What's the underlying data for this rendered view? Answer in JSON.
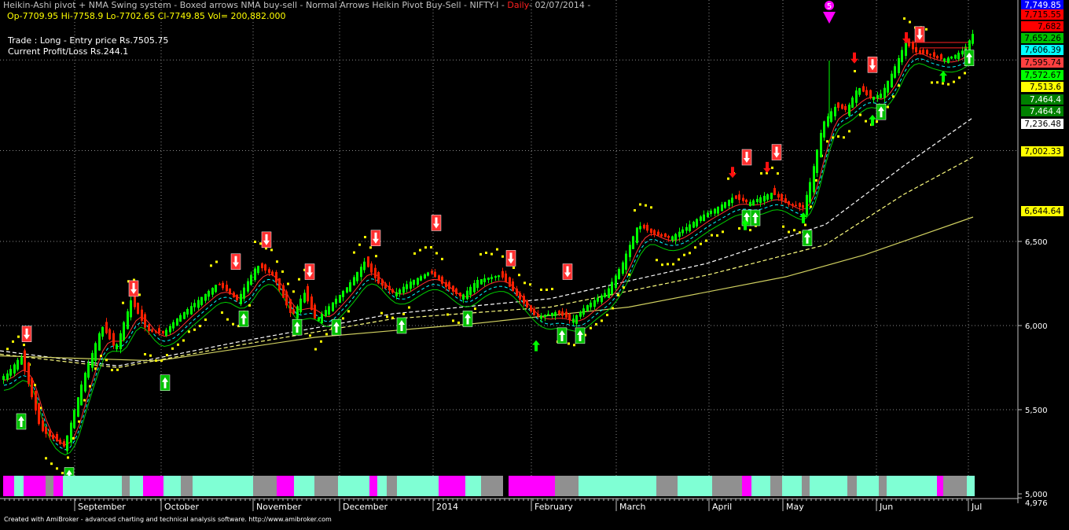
{
  "header": {
    "title": "Heikin-Ashi pivot + NMA Swing system - Boxed arrows NMA buy-sell - Normal Arrows Heikin Pivot Buy-Sell - NIFTY-I -",
    "period": "Daily",
    "date": "- 02/07/2014 -",
    "ohlc": "Op-7709.95  Hi-7758.9  Lo-7702.65  Cl-7749.85  Vol= 200,882.000"
  },
  "trade_info": {
    "line1": "Trade : Long - Entry price Rs.7505.75",
    "line2": "Current Profit/Loss Rs.244.1"
  },
  "footer": {
    "credit": "Created with AmiBroker - advanced charting and technical analysis software. http://www.amibroker.com"
  },
  "colors": {
    "background": "#000000",
    "bull_candle": "#00ff00",
    "bear_candle": "#ff2000",
    "buy_box": "#00c000",
    "sell_box": "#ff3030",
    "wave_marker": "#ff00ff",
    "grid": "#808080"
  },
  "chart_data": {
    "type": "candlestick",
    "symbol": "NIFTY-I",
    "period": "Daily",
    "ylim": [
      4970,
      7800
    ],
    "yticks": [
      {
        "label": "6,500",
        "value": 6500
      },
      {
        "label": "6,000",
        "value": 6000
      },
      {
        "label": "5,500",
        "value": 5500
      },
      {
        "label": "5,000",
        "value": 5000
      },
      {
        "label": "4,976",
        "value": 4976
      }
    ],
    "x_labels": [
      "September",
      "October",
      "November",
      "December",
      "2014",
      "February",
      "March",
      "April",
      "May",
      "Jun",
      "Jul"
    ],
    "price_keypoints": [
      {
        "x": 5,
        "y": 5700
      },
      {
        "x": 25,
        "y": 5820
      },
      {
        "x": 50,
        "y": 5380
      },
      {
        "x": 80,
        "y": 5280
      },
      {
        "x": 105,
        "y": 5700
      },
      {
        "x": 128,
        "y": 6000
      },
      {
        "x": 145,
        "y": 5860
      },
      {
        "x": 165,
        "y": 6150
      },
      {
        "x": 185,
        "y": 5970
      },
      {
        "x": 205,
        "y": 5950
      },
      {
        "x": 225,
        "y": 6050
      },
      {
        "x": 250,
        "y": 6150
      },
      {
        "x": 275,
        "y": 6250
      },
      {
        "x": 300,
        "y": 6150
      },
      {
        "x": 325,
        "y": 6360
      },
      {
        "x": 345,
        "y": 6300
      },
      {
        "x": 370,
        "y": 6050
      },
      {
        "x": 385,
        "y": 6200
      },
      {
        "x": 400,
        "y": 6030
      },
      {
        "x": 420,
        "y": 6130
      },
      {
        "x": 440,
        "y": 6230
      },
      {
        "x": 462,
        "y": 6380
      },
      {
        "x": 480,
        "y": 6250
      },
      {
        "x": 500,
        "y": 6190
      },
      {
        "x": 520,
        "y": 6260
      },
      {
        "x": 545,
        "y": 6320
      },
      {
        "x": 565,
        "y": 6230
      },
      {
        "x": 585,
        "y": 6170
      },
      {
        "x": 605,
        "y": 6270
      },
      {
        "x": 635,
        "y": 6300
      },
      {
        "x": 655,
        "y": 6180
      },
      {
        "x": 680,
        "y": 6050
      },
      {
        "x": 705,
        "y": 6080
      },
      {
        "x": 725,
        "y": 6030
      },
      {
        "x": 745,
        "y": 6120
      },
      {
        "x": 770,
        "y": 6200
      },
      {
        "x": 790,
        "y": 6370
      },
      {
        "x": 810,
        "y": 6600
      },
      {
        "x": 830,
        "y": 6540
      },
      {
        "x": 850,
        "y": 6520
      },
      {
        "x": 870,
        "y": 6580
      },
      {
        "x": 890,
        "y": 6650
      },
      {
        "x": 910,
        "y": 6700
      },
      {
        "x": 930,
        "y": 6760
      },
      {
        "x": 950,
        "y": 6730
      },
      {
        "x": 965,
        "y": 6760
      },
      {
        "x": 980,
        "y": 6790
      },
      {
        "x": 1000,
        "y": 6720
      },
      {
        "x": 1020,
        "y": 6700
      },
      {
        "x": 1030,
        "y": 6870
      },
      {
        "x": 1045,
        "y": 7200
      },
      {
        "x": 1060,
        "y": 7300
      },
      {
        "x": 1075,
        "y": 7280
      },
      {
        "x": 1090,
        "y": 7420
      },
      {
        "x": 1105,
        "y": 7350
      },
      {
        "x": 1120,
        "y": 7380
      },
      {
        "x": 1135,
        "y": 7520
      },
      {
        "x": 1150,
        "y": 7680
      },
      {
        "x": 1165,
        "y": 7620
      },
      {
        "x": 1180,
        "y": 7610
      },
      {
        "x": 1195,
        "y": 7580
      },
      {
        "x": 1210,
        "y": 7600
      },
      {
        "x": 1225,
        "y": 7640
      },
      {
        "x": 1238,
        "y": 7749.85
      }
    ],
    "last_bar": {
      "open": 7709.95,
      "high": 7758.9,
      "low": 7702.65,
      "close": 7749.85,
      "volume": 200882
    },
    "price_labels": [
      {
        "text": "7,749.85",
        "value": 7749.85,
        "bg": "#0000ff",
        "fg": "#ffffff"
      },
      {
        "text": "7,715.55",
        "value": 7715.55,
        "bg": "#ff0000",
        "fg": "#000000"
      },
      {
        "text": "7,682",
        "value": 7682,
        "bg": "#ff0000",
        "fg": "#000000"
      },
      {
        "text": "7,652.26",
        "value": 7652.26,
        "bg": "#00c000",
        "fg": "#000000"
      },
      {
        "text": "7,606.39",
        "value": 7606.39,
        "bg": "#00ffff",
        "fg": "#000000"
      },
      {
        "text": "7,595.74",
        "value": 7595.74,
        "bg": "#ff4040",
        "fg": "#000000"
      },
      {
        "text": "7,572.67",
        "value": 7572.67,
        "bg": "#00ff00",
        "fg": "#000000"
      },
      {
        "text": "7,513.6",
        "value": 7513.6,
        "bg": "#ffff00",
        "fg": "#000000"
      },
      {
        "text": "7,464.4",
        "value": 7464.4,
        "bg": "#008000",
        "fg": "#ffffff"
      },
      {
        "text": "7,464.4",
        "value": 7464.4,
        "bg": "#008000",
        "fg": "#ffffff"
      },
      {
        "text": "7,236.48",
        "value": 7236.48,
        "bg": "#ffffff",
        "fg": "#000000"
      },
      {
        "text": "7,002.33",
        "value": 7002.33,
        "bg": "#ffff00",
        "fg": "#000000"
      },
      {
        "text": "6,644.64",
        "value": 6644.64,
        "bg": "#ffff00",
        "fg": "#000000"
      }
    ],
    "moving_averages": [
      {
        "style": "dashed",
        "color": "#ffffff",
        "end_value": 7236.48,
        "points": [
          [
            0,
            5850
          ],
          [
            150,
            5760
          ],
          [
            300,
            5900
          ],
          [
            500,
            6070
          ],
          [
            700,
            6160
          ],
          [
            900,
            6370
          ],
          [
            1050,
            6600
          ],
          [
            1150,
            6950
          ],
          [
            1238,
            7236
          ]
        ]
      },
      {
        "style": "dashed",
        "color": "#ffff80",
        "end_value": 7002.33,
        "points": [
          [
            0,
            5830
          ],
          [
            150,
            5750
          ],
          [
            300,
            5880
          ],
          [
            500,
            6040
          ],
          [
            700,
            6110
          ],
          [
            900,
            6300
          ],
          [
            1050,
            6480
          ],
          [
            1150,
            6780
          ],
          [
            1238,
            7002
          ]
        ]
      },
      {
        "style": "solid",
        "color": "#d0d060",
        "end_value": 6644.64,
        "points": [
          [
            0,
            5820
          ],
          [
            200,
            5790
          ],
          [
            400,
            5930
          ],
          [
            600,
            6010
          ],
          [
            800,
            6110
          ],
          [
            1000,
            6290
          ],
          [
            1100,
            6420
          ],
          [
            1238,
            6645
          ]
        ]
      }
    ],
    "buy_box_arrows": [
      {
        "x": 27,
        "price": 5430
      },
      {
        "x": 88,
        "price": 5110
      },
      {
        "x": 210,
        "price": 5660
      },
      {
        "x": 310,
        "price": 6040
      },
      {
        "x": 378,
        "price": 5990
      },
      {
        "x": 428,
        "price": 5990
      },
      {
        "x": 511,
        "price": 6000
      },
      {
        "x": 595,
        "price": 6040
      },
      {
        "x": 715,
        "price": 5940
      },
      {
        "x": 738,
        "price": 5940
      },
      {
        "x": 950,
        "price": 6640
      },
      {
        "x": 961,
        "price": 6640
      },
      {
        "x": 1027,
        "price": 6520
      },
      {
        "x": 1121,
        "price": 7270
      },
      {
        "x": 1233,
        "price": 7590
      }
    ],
    "sell_box_arrows": [
      {
        "x": 34,
        "price": 5950
      },
      {
        "x": 170,
        "price": 6220
      },
      {
        "x": 300,
        "price": 6380
      },
      {
        "x": 339,
        "price": 6510
      },
      {
        "x": 394,
        "price": 6320
      },
      {
        "x": 478,
        "price": 6520
      },
      {
        "x": 555,
        "price": 6610
      },
      {
        "x": 650,
        "price": 6400
      },
      {
        "x": 722,
        "price": 6320
      },
      {
        "x": 950,
        "price": 7000
      },
      {
        "x": 988,
        "price": 7030
      },
      {
        "x": 1110,
        "price": 7550
      },
      {
        "x": 1170,
        "price": 7730
      }
    ],
    "buy_arrows": [
      {
        "x": 682,
        "price": 5880
      },
      {
        "x": 1110,
        "price": 7220
      },
      {
        "x": 1200,
        "price": 7480
      },
      {
        "x": 1022,
        "price": 6640
      },
      {
        "x": 948,
        "price": 6600
      }
    ],
    "sell_arrows": [
      {
        "x": 932,
        "price": 6910
      },
      {
        "x": 976,
        "price": 6940
      },
      {
        "x": 1087,
        "price": 7590
      },
      {
        "x": 1153,
        "price": 7710
      }
    ],
    "wave_marker": {
      "x": 1055,
      "label": "5"
    },
    "trend_bar": {
      "colors": {
        "up": "#7fffd4",
        "down": "#ff00ff",
        "neutral": "#909090"
      },
      "segments": [
        [
          "down",
          4,
          18
        ],
        [
          "up",
          18,
          30
        ],
        [
          "down",
          30,
          58
        ],
        [
          "neutral",
          58,
          68
        ],
        [
          "down",
          68,
          80
        ],
        [
          "up",
          80,
          155
        ],
        [
          "neutral",
          155,
          165
        ],
        [
          "up",
          165,
          182
        ],
        [
          "down",
          182,
          208
        ],
        [
          "up",
          208,
          230
        ],
        [
          "neutral",
          230,
          245
        ],
        [
          "up",
          245,
          322
        ],
        [
          "neutral",
          322,
          352
        ],
        [
          "down",
          352,
          374
        ],
        [
          "up",
          374,
          400
        ],
        [
          "neutral",
          400,
          430
        ],
        [
          "up",
          430,
          470
        ],
        [
          "down",
          470,
          480
        ],
        [
          "up",
          480,
          492
        ],
        [
          "neutral",
          492,
          505
        ],
        [
          "up",
          505,
          558
        ],
        [
          "down",
          558,
          592
        ],
        [
          "up",
          592,
          612
        ],
        [
          "neutral",
          612,
          640
        ],
        [
          "down",
          647,
          706
        ],
        [
          "neutral",
          706,
          736
        ],
        [
          "up",
          736,
          835
        ],
        [
          "neutral",
          835,
          862
        ],
        [
          "up",
          862,
          906
        ],
        [
          "neutral",
          906,
          944
        ],
        [
          "down",
          944,
          956
        ],
        [
          "up",
          956,
          980
        ],
        [
          "neutral",
          980,
          995
        ],
        [
          "up",
          995,
          1020
        ],
        [
          "neutral",
          1020,
          1030
        ],
        [
          "up",
          1030,
          1078
        ],
        [
          "neutral",
          1078,
          1090
        ],
        [
          "up",
          1090,
          1118
        ],
        [
          "neutral",
          1118,
          1128
        ],
        [
          "up",
          1128,
          1192
        ],
        [
          "down",
          1192,
          1200
        ],
        [
          "neutral",
          1200,
          1230
        ],
        [
          "up",
          1230,
          1240
        ]
      ]
    }
  }
}
